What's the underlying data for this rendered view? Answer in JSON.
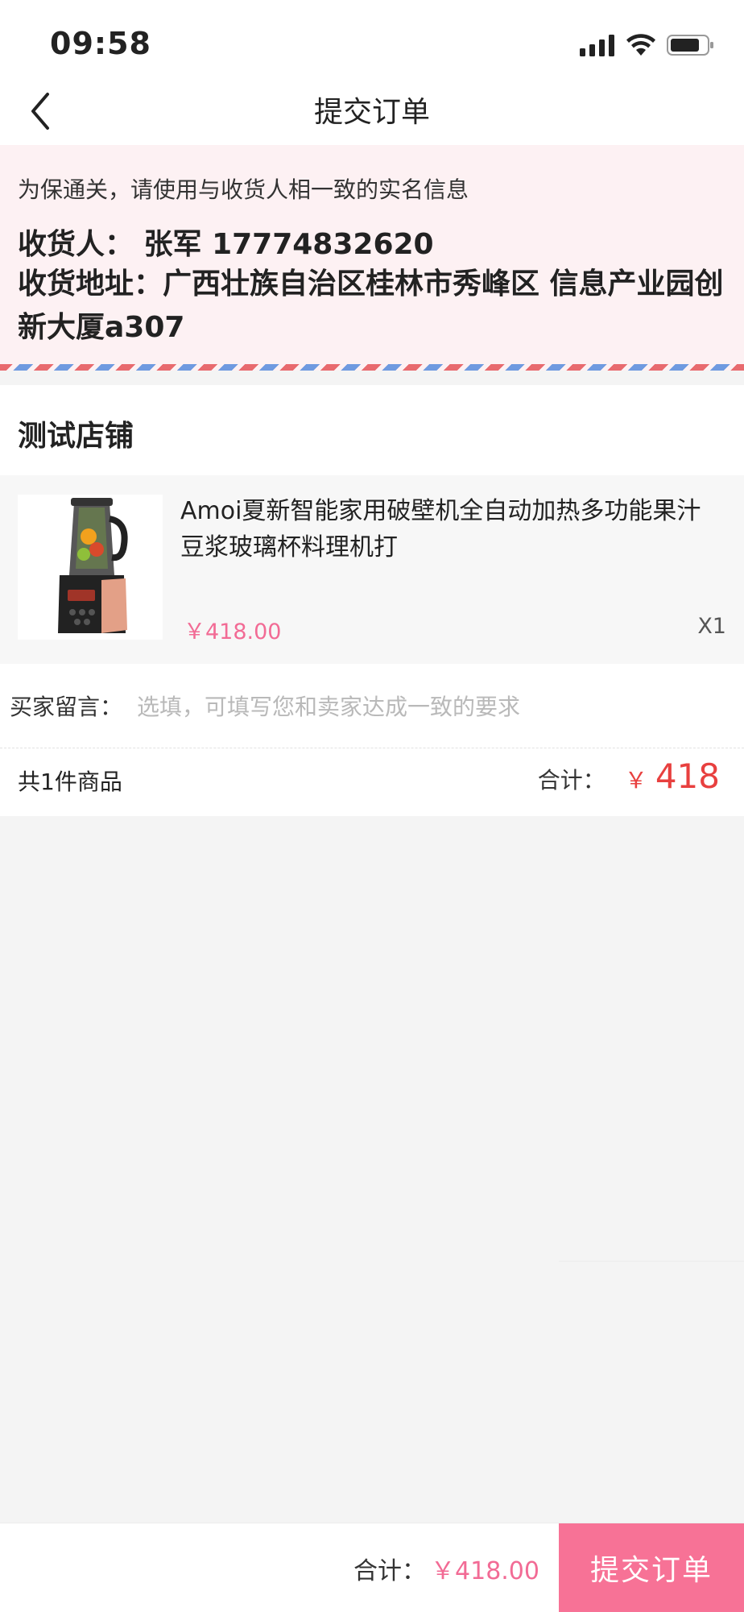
{
  "status_bar": {
    "time": "09:58",
    "icons": [
      "signal-icon",
      "wifi-icon",
      "battery-icon"
    ]
  },
  "nav": {
    "title": "提交订单",
    "back_icon": "chevron-left-icon"
  },
  "address": {
    "notice": "为保通关，请使用与收货人相一致的实名信息",
    "receiver": "收货人：  张军  17774832620",
    "address": "收货地址：广西壮族自治区桂林市秀峰区 信息产业园创新大厦a307"
  },
  "shop": {
    "name": "测试店铺"
  },
  "product": {
    "title": "Amoi夏新智能家用破壁机全自动加热多功能果汁豆浆玻璃杯料理机打",
    "price": "￥418.00",
    "quantity": "X1"
  },
  "message": {
    "label": "买家留言：",
    "placeholder": "选填，可填写您和卖家达成一致的要求",
    "value": ""
  },
  "summary": {
    "count": "共1件商品",
    "total_label": "合计：",
    "currency": "￥",
    "total_amount": "418"
  },
  "footer": {
    "total_label": "合计：",
    "total_value": "￥418.00",
    "submit_label": "提交订单"
  },
  "colors": {
    "accent_pink": "#f77296",
    "price_pink": "#f26b95",
    "total_red": "#e8403f",
    "address_bg": "#fdf1f3"
  }
}
